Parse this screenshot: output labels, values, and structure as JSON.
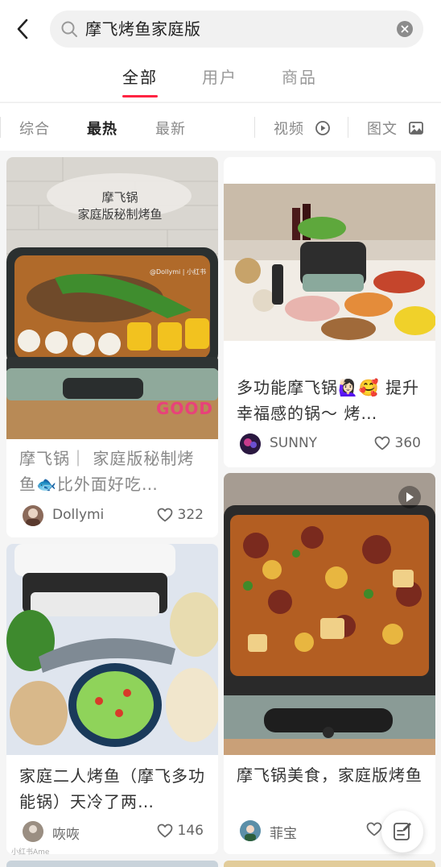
{
  "search": {
    "query": "摩飞烤鱼家庭版"
  },
  "tabs": [
    "全部",
    "用户",
    "商品"
  ],
  "filters": {
    "sort": [
      "综合",
      "最热",
      "最新"
    ],
    "video": "视频",
    "image_text": "图文"
  },
  "cards": [
    {
      "title": "摩飞锅｜ 家庭版秘制烤鱼🐟比外面好吃…",
      "image_text": "摩飞锅\n家庭版秘制烤鱼",
      "image_watermark": "@Dollymi | 小红书",
      "image_sticker": "GOOD",
      "author": "Dollymi",
      "likes": "322"
    },
    {
      "title": "多功能摩飞锅🙋🏻‍♀️🥰 提升幸福感的锅～ 烤…",
      "author": "SUNNY",
      "likes": "360"
    },
    {
      "title": "家庭二人烤鱼（摩飞多功能锅）天冷了两…",
      "author": "咴咴",
      "likes": "146"
    },
    {
      "title": "摩飞锅美食，家庭版烤鱼",
      "author": "菲宝",
      "likes": ""
    }
  ],
  "watermark": "小红书Ame"
}
